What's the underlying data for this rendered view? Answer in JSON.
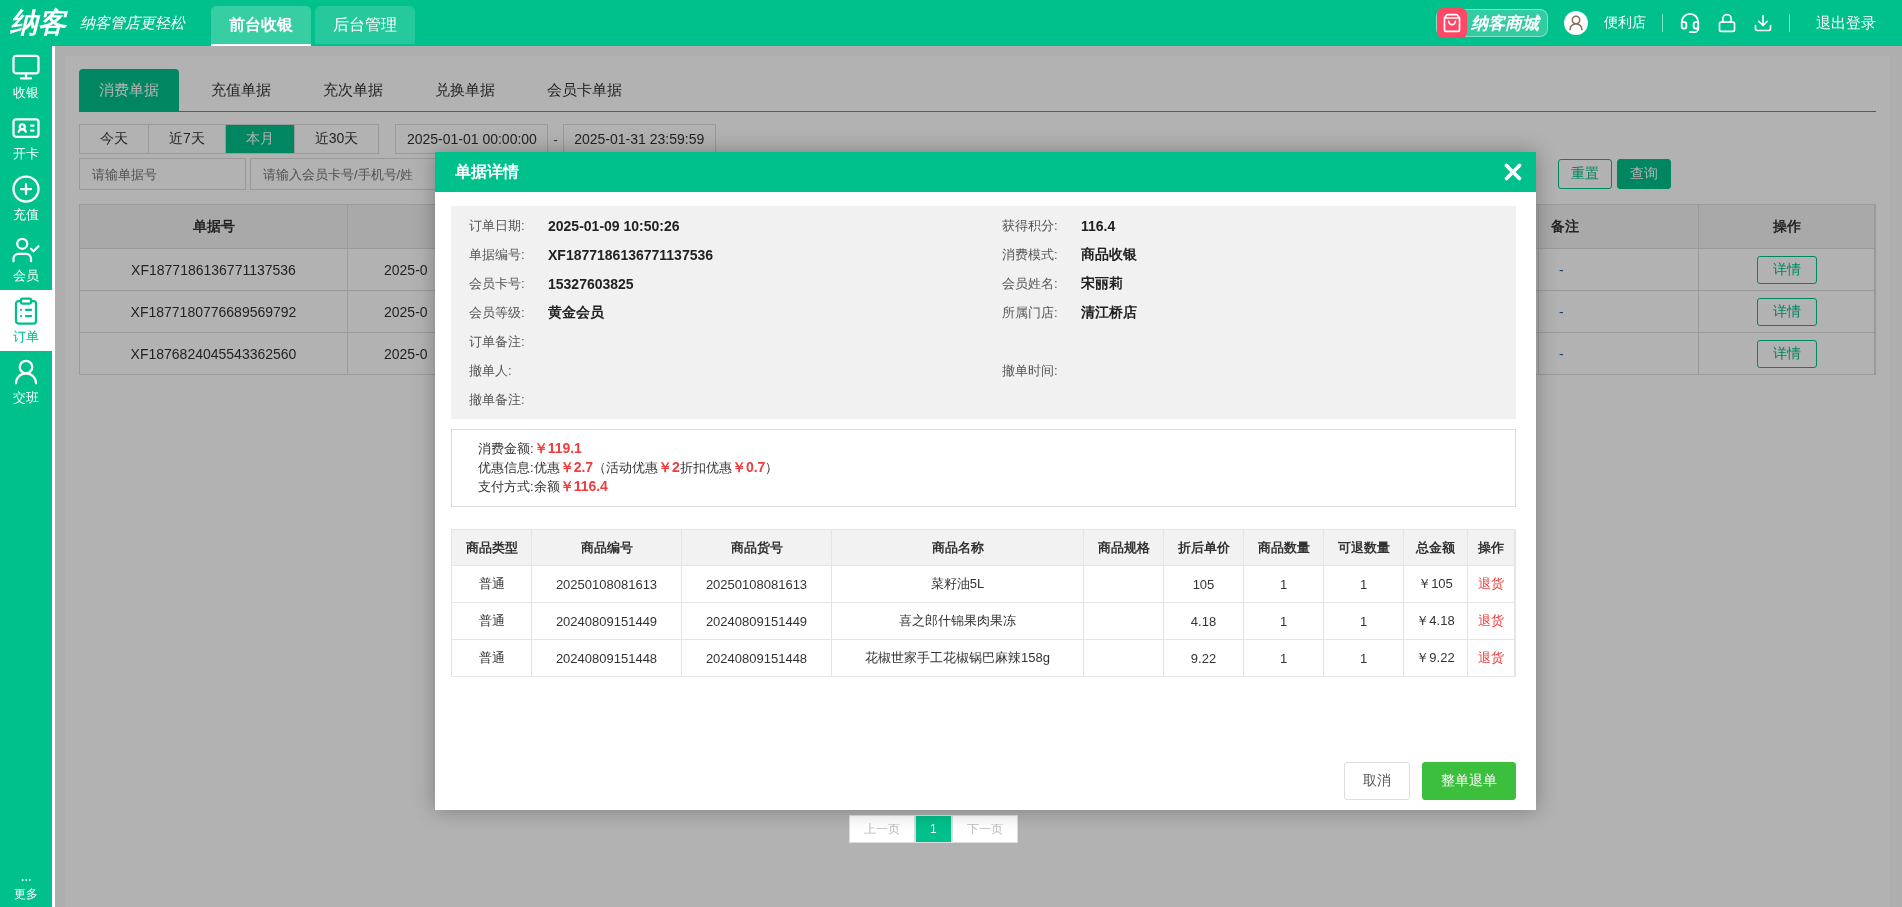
{
  "header": {
    "logo": "纳客",
    "slogan": "纳客管店更轻松",
    "tabs": [
      {
        "label": "前台收银",
        "selected": true
      },
      {
        "label": "后台管理",
        "selected": false
      }
    ],
    "mall": "纳客商城",
    "store": "便利店",
    "logout": "退出登录"
  },
  "sidebar": {
    "items": [
      {
        "label": "收银",
        "selected": false
      },
      {
        "label": "开卡",
        "selected": false
      },
      {
        "label": "充值",
        "selected": false
      },
      {
        "label": "会员",
        "selected": false
      },
      {
        "label": "订单",
        "selected": true
      },
      {
        "label": "交班",
        "selected": false
      }
    ],
    "more": "更多"
  },
  "tabs": [
    {
      "label": "消费单据",
      "selected": true
    },
    {
      "label": "充值单据",
      "selected": false
    },
    {
      "label": "充次单据",
      "selected": false
    },
    {
      "label": "兑换单据",
      "selected": false
    },
    {
      "label": "会员卡单据",
      "selected": false
    }
  ],
  "quick_ranges": [
    {
      "label": "今天",
      "selected": false
    },
    {
      "label": "近7天",
      "selected": false
    },
    {
      "label": "本月",
      "selected": true
    },
    {
      "label": "近30天",
      "selected": false
    }
  ],
  "date_from": "2025-01-01 00:00:00",
  "date_separator": "-",
  "date_to": "2025-01-31 23:59:59",
  "search": [
    {
      "placeholder": "请输单据号"
    },
    {
      "placeholder": "请输入会员卡号/手机号/姓"
    }
  ],
  "reset": "重置",
  "query": "查询",
  "table": {
    "columns": [
      "单据号",
      "备注",
      "操作"
    ],
    "rows": [
      {
        "number": "XF1877186136771137536",
        "column_2": "2025-0",
        "note": "-",
        "action": "详情"
      },
      {
        "number": "XF1877180776689569792",
        "column_2": "2025-0",
        "note": "-",
        "action": "详情"
      },
      {
        "number": "XF1876824045543362560",
        "column_2": "2025-0",
        "note": "-",
        "action": "详情"
      }
    ]
  },
  "pagination": {
    "prev": "上一页",
    "pages": [
      {
        "label": "1",
        "selected": true
      }
    ],
    "next": "下一页"
  },
  "dialog": {
    "title": "单据详情",
    "info": [
      {
        "left": {
          "label": "订单日期:",
          "value": "2025-01-09 10:50:26"
        },
        "right": {
          "label": "获得积分:",
          "value": "116.4"
        }
      },
      {
        "left": {
          "label": "单据编号:",
          "value": "XF1877186136771137536"
        },
        "right": {
          "label": "消费模式:",
          "value": "商品收银"
        }
      },
      {
        "left": {
          "label": "会员卡号:",
          "value": "15327603825"
        },
        "right": {
          "label": "会员姓名:",
          "value": "宋丽莉"
        }
      },
      {
        "left": {
          "label": "会员等级:",
          "value": "黄金会员"
        },
        "right": {
          "label": "所属门店:",
          "value": "清江桥店"
        }
      },
      {
        "left": {
          "label": "订单备注:"
        }
      },
      {
        "left": {
          "label": "撤单人:"
        },
        "right": {
          "label": "撤单时间:"
        }
      },
      {
        "left": {
          "label": "撤单备注:"
        }
      }
    ],
    "summary": [
      {
        "label": "消费金额:",
        "parts": [
          {
            "text": "￥119.1",
            "emphasis": true
          }
        ]
      },
      {
        "label": "优惠信息:",
        "parts": [
          {
            "text": "优惠",
            "emphasis": false
          },
          {
            "text": "￥2.7",
            "emphasis": true
          },
          {
            "text": "（活动优惠",
            "emphasis": false
          },
          {
            "text": "￥2",
            "emphasis": true
          },
          {
            "text": "折扣优惠",
            "emphasis": false
          },
          {
            "text": "￥0.7",
            "emphasis": true
          },
          {
            "text": "）",
            "emphasis": false
          }
        ]
      },
      {
        "label": "支付方式:",
        "parts": [
          {
            "text": "余额",
            "emphasis": false
          },
          {
            "text": "￥116.4",
            "emphasis": true
          }
        ]
      }
    ],
    "items": {
      "columns": [
        "商品类型",
        "商品编号",
        "商品货号",
        "商品名称",
        "商品规格",
        "折后单价",
        "商品数量",
        "可退数量",
        "总金额",
        "操作"
      ],
      "rows": [
        {
          "cells": [
            "普通",
            "20250108081613",
            "20250108081613",
            "菜籽油5L",
            "",
            "105",
            "1",
            "1",
            "￥105"
          ],
          "action": "退货"
        },
        {
          "cells": [
            "普通",
            "20240809151449",
            "20240809151449",
            "喜之郎什锦果肉果冻",
            "",
            "4.18",
            "1",
            "1",
            "￥4.18"
          ],
          "action": "退货"
        },
        {
          "cells": [
            "普通",
            "20240809151448",
            "20240809151448",
            "花椒世家手工花椒锅巴麻辣158g",
            "",
            "9.22",
            "1",
            "1",
            "￥9.22"
          ],
          "action": "退货"
        }
      ]
    },
    "cancel": "取消",
    "refund_all": "整单退单"
  }
}
